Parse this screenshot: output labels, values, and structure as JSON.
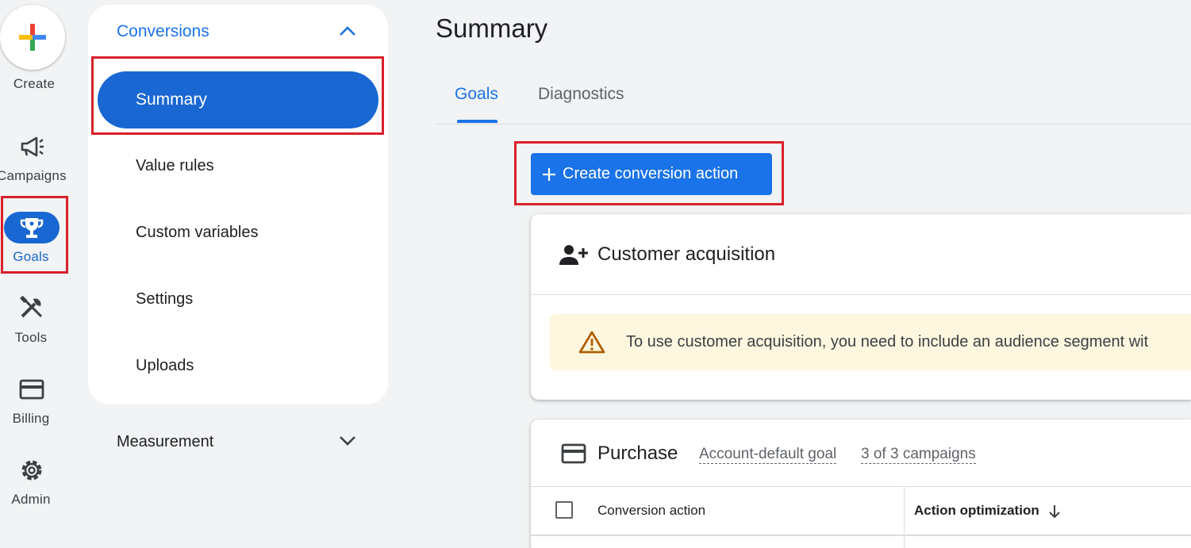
{
  "rail": {
    "create_label": "Create",
    "items": [
      {
        "label": "Campaigns",
        "icon": "megaphone-icon"
      },
      {
        "label": "Goals",
        "icon": "trophy-icon"
      },
      {
        "label": "Tools",
        "icon": "tools-icon"
      },
      {
        "label": "Billing",
        "icon": "credit-card-icon"
      },
      {
        "label": "Admin",
        "icon": "gear-icon"
      }
    ]
  },
  "nav": {
    "section_title": "Conversions",
    "items": [
      "Summary",
      "Value rules",
      "Custom variables",
      "Settings",
      "Uploads"
    ],
    "collapsed_section": "Measurement"
  },
  "main": {
    "title": "Summary",
    "tabs": [
      "Goals",
      "Diagnostics"
    ],
    "create_button_label": "Create conversion action",
    "customer_card": {
      "title": "Customer acquisition",
      "warning": "To use customer acquisition, you need to include an audience segment wit"
    },
    "purchase_card": {
      "title": "Purchase",
      "goal_chip": "Account-default goal",
      "campaigns_chip": "3 of 3 campaigns",
      "col_conversion_action": "Conversion action",
      "col_action_optimization": "Action optimization"
    }
  },
  "colors": {
    "accent": "#1a73e8",
    "selected": "#1967d2",
    "highlight": "#d9202a",
    "warning_bg": "#fef7e0"
  }
}
